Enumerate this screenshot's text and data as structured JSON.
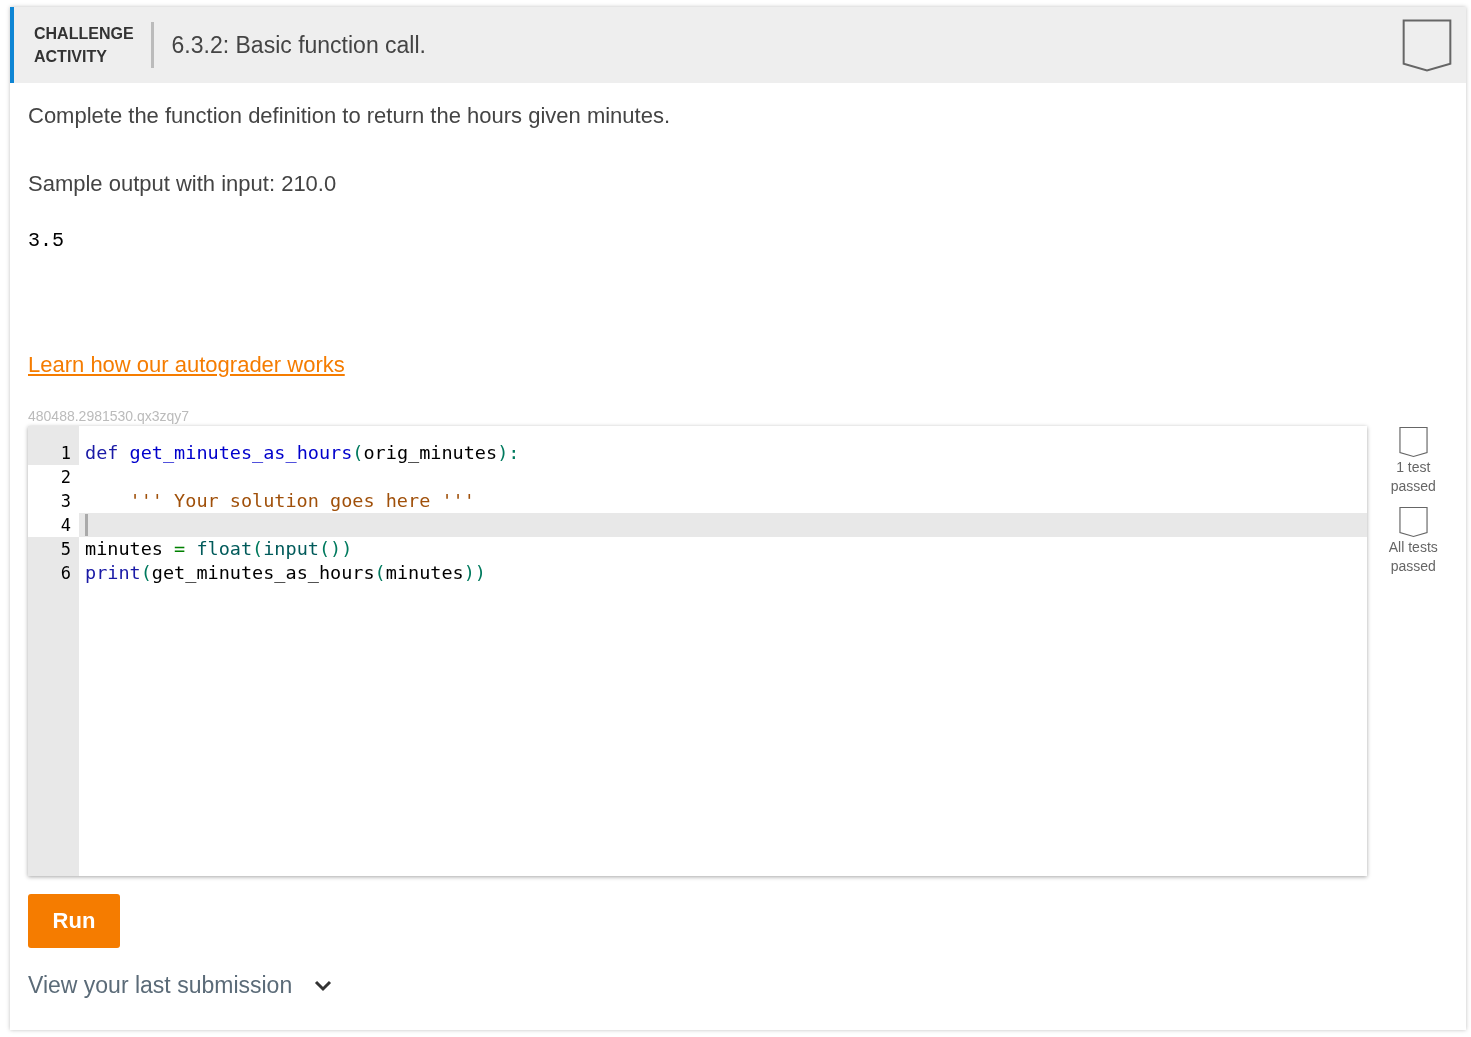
{
  "header": {
    "label_lines": [
      "CHALLENGE",
      "ACTIVITY"
    ],
    "title": "6.3.2: Basic function call.",
    "completed": false
  },
  "instructions": "Complete the function definition to return the hours given minutes.",
  "sample_label": "Sample output with input: 210.0",
  "sample_output": "3.5",
  "autograder_link": "Learn how our autograder works",
  "activity_id": "480488.2981530.qx3zqy7",
  "code_lines": [
    {
      "number": "1",
      "editable": false,
      "current": false,
      "tokens": [
        {
          "kind": "keyword",
          "text": "def "
        },
        {
          "kind": "def",
          "text": "get_minutes_as_hours"
        },
        {
          "kind": "bracket",
          "text": "("
        },
        {
          "kind": "variable",
          "text": "orig_minutes"
        },
        {
          "kind": "bracket",
          "text": ")"
        },
        {
          "kind": "punct",
          "text": ":"
        }
      ]
    },
    {
      "number": "2",
      "editable": true,
      "current": false
    },
    {
      "number": "3",
      "editable": true,
      "current": false,
      "tokens": [
        {
          "kind": "string",
          "text": "    ''' Your solution goes here '''"
        }
      ]
    },
    {
      "number": "4",
      "editable": true,
      "current": true
    },
    {
      "number": "5",
      "editable": false,
      "current": false,
      "tokens": [
        {
          "kind": "variable",
          "text": "minutes "
        },
        {
          "kind": "operator",
          "text": "= "
        },
        {
          "kind": "builtin",
          "text": "float"
        },
        {
          "kind": "bracket",
          "text": "("
        },
        {
          "kind": "builtin",
          "text": "input"
        },
        {
          "kind": "bracket",
          "text": "())"
        }
      ]
    },
    {
      "number": "6",
      "editable": false,
      "current": false,
      "tokens": [
        {
          "kind": "keyword",
          "text": "print"
        },
        {
          "kind": "bracket",
          "text": "("
        },
        {
          "kind": "variable",
          "text": "get_minutes_as_hours"
        },
        {
          "kind": "bracket",
          "text": "("
        },
        {
          "kind": "variable",
          "text": "minutes"
        },
        {
          "kind": "bracket",
          "text": "))"
        }
      ]
    }
  ],
  "tests": [
    {
      "label_lines": [
        "1 test",
        "passed"
      ],
      "passed": false
    },
    {
      "label_lines": [
        "All tests",
        "passed"
      ],
      "passed": false
    }
  ],
  "run_button": "Run",
  "last_submission": "View your last submission"
}
